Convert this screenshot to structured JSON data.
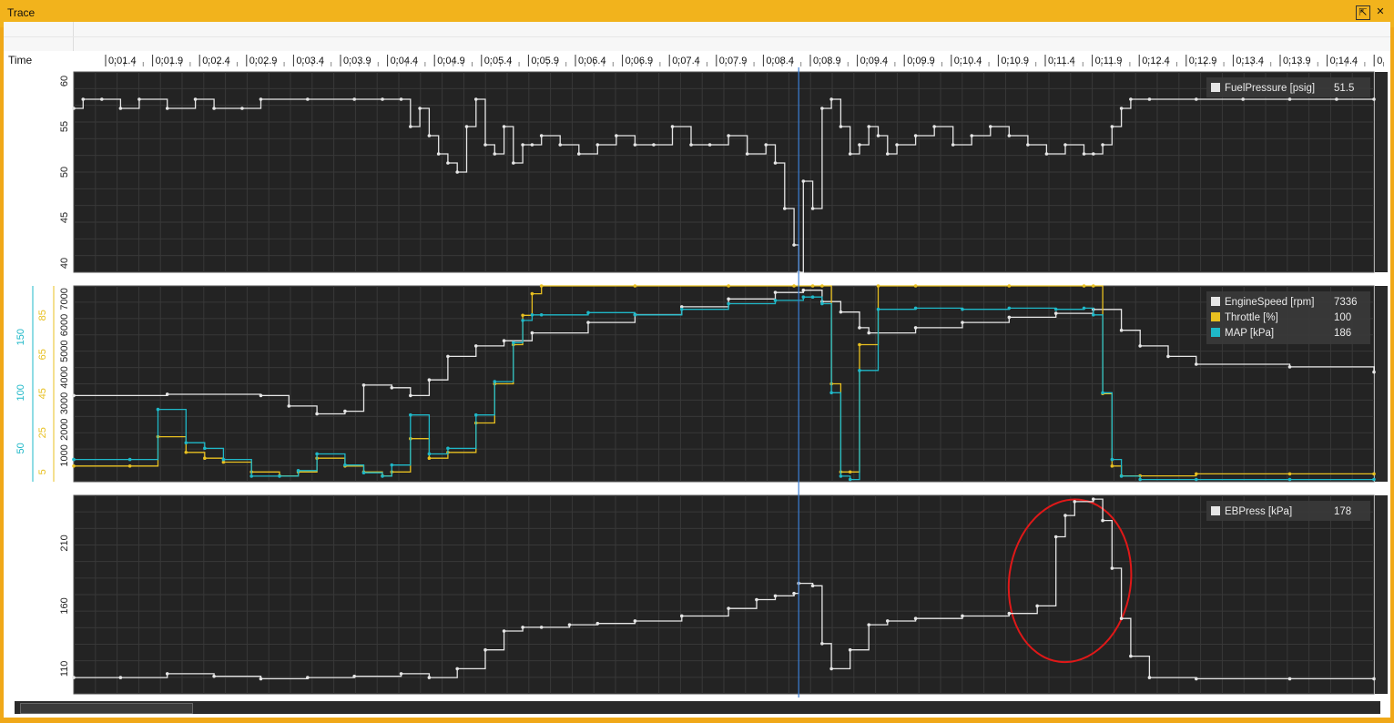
{
  "window": {
    "title": "Trace",
    "pin_icon": "pin-icon",
    "close_icon": "close-icon"
  },
  "time_axis": {
    "label": "Time",
    "ticks": [
      "0:01.4",
      "0:01.9",
      "0:02.4",
      "0:02.9",
      "0:03.4",
      "0:03.9",
      "0:04.4",
      "0:04.9",
      "0:05.4",
      "0:05.9",
      "0:06.4",
      "0:06.9",
      "0:07.4",
      "0:07.9",
      "0:08.4",
      "0:08.9",
      "0:09.4",
      "0:09.9",
      "0:10.4",
      "0:10.9",
      "0:11.4",
      "0:11.9",
      "0:12.4",
      "0:12.9",
      "0:13.4",
      "0:13.9",
      "0:14.4",
      "0"
    ]
  },
  "cursor": {
    "time_s": 8.75
  },
  "colors": {
    "white": "#e6e6e6",
    "throttle": "#e8c020",
    "map": "#1fb8c8",
    "annotation": "#e01818",
    "cursor": "#3a7fd6",
    "panel_bg": "#232323"
  },
  "chart_data": [
    {
      "type": "line",
      "panel": "top",
      "xlim": [
        1.0,
        14.9
      ],
      "ylim": [
        39,
        61
      ],
      "yticks": [
        60,
        55,
        50,
        45,
        40
      ],
      "legend": {
        "position": "top-right",
        "entries": [
          {
            "name": "FuelPressure [psig]",
            "value": "51.5",
            "color": "#e6e6e6"
          }
        ]
      },
      "series": [
        {
          "name": "FuelPressure [psig]",
          "color": "#e6e6e6",
          "x": [
            1.0,
            1.1,
            1.3,
            1.5,
            1.7,
            2.0,
            2.3,
            2.5,
            2.8,
            3.0,
            3.5,
            4.0,
            4.3,
            4.5,
            4.6,
            4.7,
            4.8,
            4.9,
            5.0,
            5.1,
            5.2,
            5.3,
            5.4,
            5.5,
            5.6,
            5.7,
            5.8,
            5.9,
            6.0,
            6.2,
            6.4,
            6.6,
            6.8,
            7.0,
            7.2,
            7.4,
            7.6,
            7.8,
            8.0,
            8.2,
            8.4,
            8.5,
            8.6,
            8.7,
            8.75,
            8.8,
            8.9,
            9.0,
            9.1,
            9.2,
            9.3,
            9.4,
            9.5,
            9.6,
            9.7,
            9.8,
            10.0,
            10.2,
            10.4,
            10.6,
            10.8,
            11.0,
            11.2,
            11.4,
            11.6,
            11.8,
            11.9,
            12.0,
            12.1,
            12.2,
            12.3,
            12.5,
            13.0,
            13.5,
            14.0,
            14.5,
            14.9
          ],
          "y": [
            57,
            58,
            58,
            57,
            58,
            57,
            58,
            57,
            57,
            58,
            58,
            58,
            58,
            58,
            55,
            57,
            54,
            52,
            51,
            50,
            55,
            58,
            53,
            52,
            55,
            51,
            53,
            53,
            54,
            53,
            52,
            53,
            54,
            53,
            53,
            55,
            53,
            53,
            54,
            52,
            53,
            51,
            46,
            42,
            39,
            49,
            46,
            57,
            58,
            55,
            52,
            53,
            55,
            54,
            52,
            53,
            54,
            55,
            53,
            54,
            55,
            54,
            53,
            52,
            53,
            52,
            52,
            53,
            55,
            57,
            58,
            58,
            58,
            58,
            58,
            58,
            58
          ]
        }
      ]
    },
    {
      "type": "line",
      "panel": "middle",
      "xlim": [
        1.0,
        14.9
      ],
      "axes": [
        {
          "name": "EngineSpeed",
          "ylim": [
            0,
            7500
          ],
          "yticks": [
            1000,
            2000,
            3000,
            4000,
            5000,
            6000,
            7000
          ]
        },
        {
          "name": "Throttle",
          "ylim": [
            0,
            100
          ],
          "yticks": [
            5,
            25,
            45,
            65,
            85
          ]
        },
        {
          "name": "MAP",
          "ylim": [
            20,
            196
          ],
          "yticks": [
            50,
            100,
            150
          ]
        }
      ],
      "legend": {
        "position": "top-right",
        "entries": [
          {
            "name": "EngineSpeed [rpm]",
            "value": "7336",
            "color": "#e6e6e6"
          },
          {
            "name": "Throttle [%]",
            "value": "100",
            "color": "#e8c020"
          },
          {
            "name": "MAP [kPa]",
            "value": "186",
            "color": "#1fb8c8"
          }
        ]
      },
      "series": [
        {
          "name": "EngineSpeed [rpm]",
          "axis": "EngineSpeed",
          "color": "#e6e6e6",
          "x": [
            1.0,
            2.0,
            3.0,
            3.3,
            3.6,
            3.9,
            4.1,
            4.4,
            4.6,
            4.8,
            5.0,
            5.3,
            5.6,
            5.9,
            6.5,
            7.0,
            7.5,
            8.0,
            8.5,
            8.8,
            9.0,
            9.2,
            9.4,
            9.5,
            10.0,
            10.5,
            11.0,
            11.5,
            11.9,
            12.2,
            12.4,
            12.7,
            13.0,
            14.0,
            14.9
          ],
          "y": [
            3300,
            3350,
            3300,
            2900,
            2600,
            2700,
            3700,
            3600,
            3300,
            3900,
            4800,
            5200,
            5400,
            5700,
            6100,
            6400,
            6700,
            7000,
            7250,
            7336,
            6900,
            6500,
            5900,
            5700,
            5900,
            6100,
            6300,
            6450,
            6600,
            5800,
            5200,
            4800,
            4500,
            4400,
            4200
          ]
        },
        {
          "name": "Throttle [%]",
          "axis": "Throttle",
          "color": "#e8c020",
          "x": [
            1.0,
            1.6,
            1.9,
            2.2,
            2.4,
            2.6,
            2.9,
            3.2,
            3.4,
            3.6,
            3.9,
            4.1,
            4.3,
            4.4,
            4.6,
            4.8,
            5.0,
            5.3,
            5.5,
            5.7,
            5.8,
            5.9,
            6.0,
            7.0,
            8.0,
            8.7,
            8.9,
            9.0,
            9.1,
            9.2,
            9.3,
            9.4,
            9.6,
            10.0,
            11.0,
            11.8,
            11.9,
            12.0,
            12.1,
            12.2,
            12.4,
            13.0,
            14.0,
            14.9
          ],
          "y": [
            8,
            8,
            23,
            15,
            12,
            10,
            5,
            3,
            5,
            12,
            8,
            5,
            3,
            5,
            22,
            12,
            15,
            30,
            50,
            70,
            85,
            96,
            100,
            100,
            100,
            100,
            100,
            100,
            50,
            5,
            5,
            70,
            100,
            100,
            100,
            100,
            100,
            45,
            8,
            3,
            3,
            4,
            4,
            4
          ]
        },
        {
          "name": "MAP [kPa]",
          "axis": "MAP",
          "color": "#1fb8c8",
          "x": [
            1.0,
            1.6,
            1.9,
            2.2,
            2.4,
            2.6,
            2.9,
            3.2,
            3.4,
            3.6,
            3.9,
            4.1,
            4.3,
            4.4,
            4.6,
            4.8,
            5.0,
            5.3,
            5.5,
            5.7,
            5.8,
            5.9,
            6.0,
            6.5,
            7.0,
            7.5,
            8.0,
            8.5,
            8.8,
            8.9,
            9.0,
            9.1,
            9.2,
            9.3,
            9.4,
            9.6,
            10.0,
            10.5,
            11.0,
            11.5,
            11.8,
            11.9,
            12.0,
            12.1,
            12.2,
            12.4,
            13.0,
            14.0,
            14.9
          ],
          "y": [
            40,
            40,
            85,
            55,
            50,
            40,
            25,
            25,
            30,
            45,
            35,
            28,
            25,
            35,
            80,
            45,
            50,
            80,
            110,
            145,
            165,
            170,
            170,
            172,
            170,
            175,
            180,
            183,
            186,
            186,
            180,
            100,
            25,
            22,
            120,
            175,
            176,
            175,
            176,
            175,
            176,
            170,
            100,
            40,
            25,
            22,
            22,
            22,
            22
          ]
        }
      ]
    },
    {
      "type": "line",
      "panel": "bottom",
      "xlim": [
        1.0,
        14.9
      ],
      "ylim": [
        90,
        248
      ],
      "yticks": [
        110,
        160,
        210
      ],
      "legend": {
        "position": "top-right",
        "entries": [
          {
            "name": "EBPress [kPa]",
            "value": "178",
            "color": "#e6e6e6"
          }
        ]
      },
      "annotation": {
        "kind": "freehand-circle",
        "color": "#e01818",
        "x_range": [
          11.0,
          12.3
        ],
        "y_range": [
          115,
          245
        ]
      },
      "series": [
        {
          "name": "EBPress [kPa]",
          "color": "#e6e6e6",
          "x": [
            1.0,
            1.5,
            2.0,
            2.5,
            3.0,
            3.5,
            4.0,
            4.5,
            4.8,
            5.1,
            5.4,
            5.6,
            5.8,
            6.0,
            6.3,
            6.6,
            7.0,
            7.5,
            8.0,
            8.3,
            8.5,
            8.7,
            8.75,
            8.9,
            9.0,
            9.1,
            9.3,
            9.5,
            9.7,
            10.0,
            10.5,
            11.0,
            11.3,
            11.5,
            11.6,
            11.7,
            11.9,
            12.0,
            12.1,
            12.2,
            12.3,
            12.5,
            13.0,
            14.0,
            14.9
          ],
          "y": [
            103,
            103,
            106,
            104,
            102,
            103,
            104,
            106,
            103,
            110,
            125,
            140,
            143,
            143,
            145,
            146,
            148,
            152,
            158,
            165,
            168,
            170,
            178,
            176,
            130,
            110,
            125,
            145,
            148,
            150,
            152,
            154,
            160,
            215,
            232,
            243,
            245,
            228,
            190,
            150,
            120,
            103,
            102,
            102,
            102
          ]
        }
      ]
    }
  ]
}
